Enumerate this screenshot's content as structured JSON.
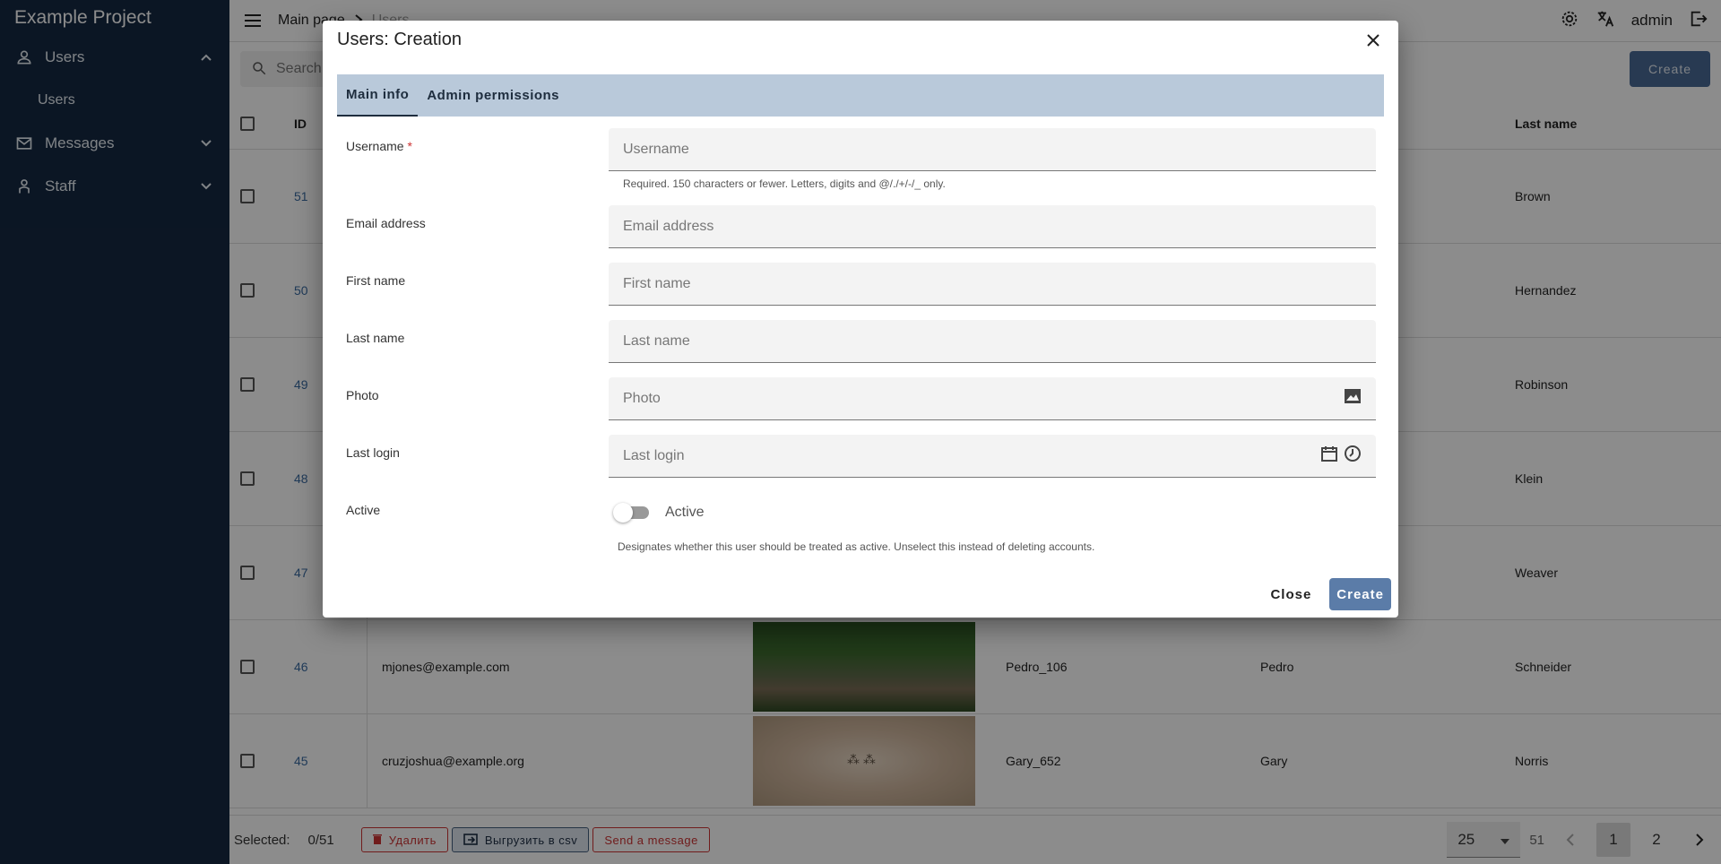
{
  "app": {
    "title": "Example Project"
  },
  "sidebar": {
    "items": [
      {
        "label": "Users",
        "expanded": true,
        "icon": "person-icon",
        "children": [
          {
            "label": "Users"
          }
        ]
      },
      {
        "label": "Messages",
        "expanded": false,
        "icon": "mail-icon"
      },
      {
        "label": "Staff",
        "expanded": false,
        "icon": "staff-icon"
      }
    ]
  },
  "header": {
    "breadcrumbs": [
      "Main page",
      "Users"
    ],
    "user": "admin"
  },
  "toolbar": {
    "search_placeholder": "Search",
    "create_label": "Create"
  },
  "table": {
    "columns": {
      "id": "ID",
      "last_name": "Last name"
    },
    "rows": [
      {
        "id": "51",
        "email": "",
        "username": "",
        "first": "",
        "last": "Brown"
      },
      {
        "id": "50",
        "email": "",
        "username": "",
        "first": "",
        "last": "Hernandez"
      },
      {
        "id": "49",
        "email": "",
        "username": "",
        "first": "",
        "last": "Robinson"
      },
      {
        "id": "48",
        "email": "",
        "username": "",
        "first": "",
        "last": "Klein"
      },
      {
        "id": "47",
        "email": "",
        "username": "",
        "first": "",
        "last": "Weaver"
      },
      {
        "id": "46",
        "email": "mjones@example.com",
        "username": "Pedro_106",
        "first": "Pedro",
        "last": "Schneider"
      },
      {
        "id": "45",
        "email": "cruzjoshua@example.org",
        "username": "Gary_652",
        "first": "Gary",
        "last": "Norris"
      }
    ]
  },
  "footer": {
    "selected_label": "Selected:",
    "selected_count": "0/51",
    "delete_label": "Удалить",
    "csv_label": "Выгрузить в csv",
    "message_label": "Send a message",
    "per_page": "25",
    "total": "51",
    "pages": [
      "1",
      "2"
    ]
  },
  "dialog": {
    "title": "Users: Creation",
    "tabs": [
      "Main info",
      "Admin permissions"
    ],
    "fields": {
      "username": {
        "label": "Username",
        "placeholder": "Username",
        "required_mark": "*",
        "hint": "Required. 150 characters or fewer. Letters, digits and @/./+/-/_ only."
      },
      "email": {
        "label": "Email address",
        "placeholder": "Email address"
      },
      "first_name": {
        "label": "First name",
        "placeholder": "First name"
      },
      "last_name": {
        "label": "Last name",
        "placeholder": "Last name"
      },
      "photo": {
        "label": "Photo",
        "placeholder": "Photo"
      },
      "last_login": {
        "label": "Last login",
        "placeholder": "Last login"
      },
      "active": {
        "label": "Active",
        "toggle_label": "Active",
        "checked": false,
        "hint": "Designates whether this user should be treated as active. Unselect this instead of deleting accounts."
      }
    },
    "close_label": "Close",
    "create_label": "Create"
  },
  "colors": {
    "sidebar": "#152842",
    "primary": "#5b7ca8",
    "tabs_bg": "#b9c9da",
    "danger": "#cc3333"
  }
}
